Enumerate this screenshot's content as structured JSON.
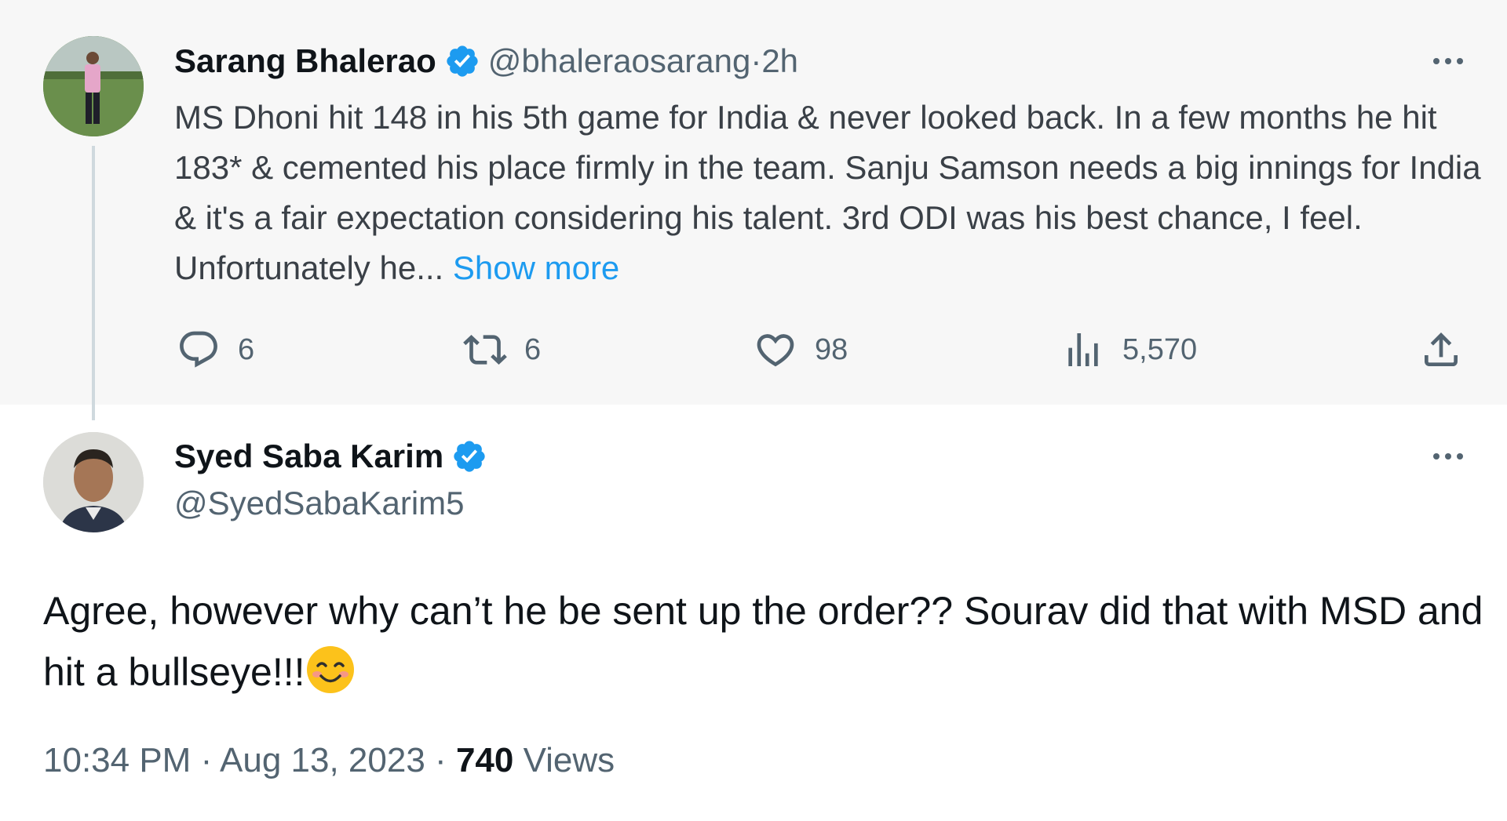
{
  "parent": {
    "display_name": "Sarang Bhalerao",
    "handle": "@bhaleraosarang",
    "separator": " · ",
    "time": "2h",
    "text": "MS Dhoni hit 148 in his 5th game for India & never looked back. In a few months he hit 183* & cemented his place firmly in the team. Sanju Samson needs a big innings for India & it's a fair expectation considering his talent. 3rd ODI was his best chance, I feel. Unfortunately he...",
    "show_more": " Show more",
    "actions": {
      "replies": "6",
      "retweets": "6",
      "likes": "98",
      "views": "5,570"
    },
    "icons": [
      "verified-badge-icon",
      "more-icon",
      "reply-icon",
      "retweet-icon",
      "like-icon",
      "views-icon",
      "share-icon"
    ]
  },
  "reply": {
    "display_name": "Syed Saba Karim",
    "handle": "@SyedSabaKarim5",
    "text": "Agree, however why can’t he be sent up the order?? Sourav did that with MSD and hit a bullseye!!!",
    "emoji": "smiling-face-icon",
    "time": "10:34 PM",
    "dot1": " · ",
    "date": "Aug 13, 2023",
    "dot2": " · ",
    "views_count": "740",
    "views_label": " Views"
  },
  "colors": {
    "accent": "#1d9bf0",
    "text_primary": "#0f1419",
    "text_secondary": "#536471",
    "parent_bg": "#f7f7f7"
  }
}
